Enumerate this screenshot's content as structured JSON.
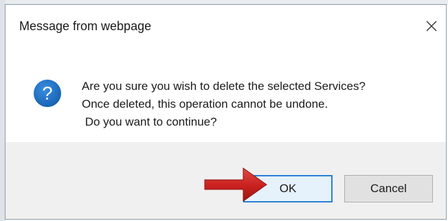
{
  "dialog": {
    "title": "Message from webpage",
    "close_glyph": "✕",
    "icon": "question-icon",
    "icon_glyph": "?",
    "message_lines": [
      "Are you sure you wish to delete the selected Services?",
      "Once deleted, this operation cannot be undone.",
      " Do you want to continue?"
    ],
    "ok_label": "OK",
    "cancel_label": "Cancel"
  },
  "colors": {
    "icon_blue": "#1c6fc4",
    "ok_border": "#2a7fd4",
    "arrow_red": "#c8201e",
    "footer_bg": "#f0f0f0"
  },
  "annotation": {
    "type": "arrow",
    "points_to": "ok-button"
  }
}
